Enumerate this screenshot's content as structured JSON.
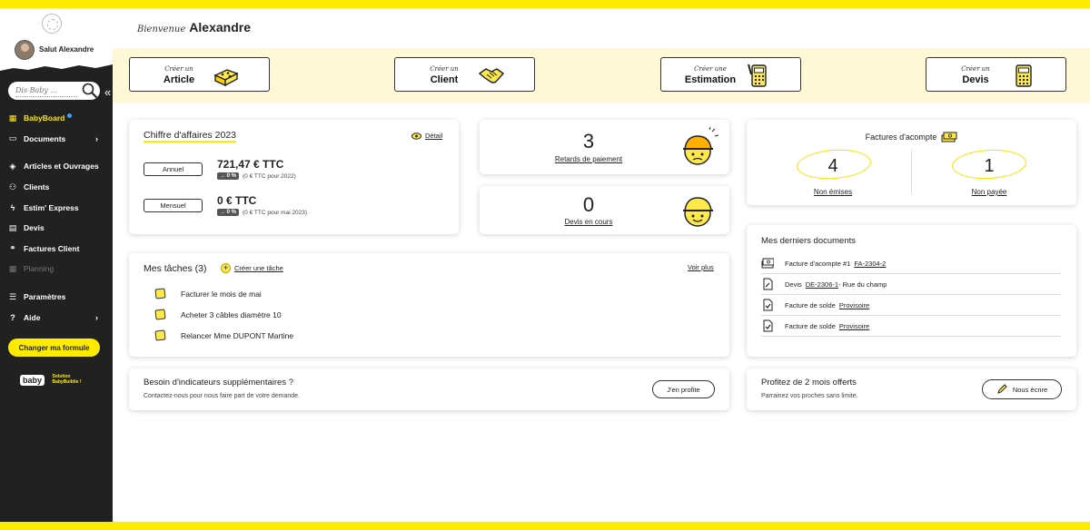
{
  "colors": {
    "accent": "#ffeb00",
    "sidebar": "#212121",
    "quick_bg": "#fff8d6",
    "link_dot": "#3ba0ff"
  },
  "sidebar": {
    "greeting": "Salut Alexandre",
    "search_placeholder": "Dis Baby ...",
    "items": [
      {
        "label": "BabyBoard",
        "icon": "grid-icon"
      },
      {
        "label": "Documents",
        "icon": "folder-icon"
      },
      {
        "label": "Articles et Ouvrages",
        "icon": "tags-icon"
      },
      {
        "label": "Clients",
        "icon": "users-icon"
      },
      {
        "label": "Estim' Express",
        "icon": "bolt-icon"
      },
      {
        "label": "Devis",
        "icon": "document-icon"
      },
      {
        "label": "Factures Client",
        "icon": "handshake-icon"
      },
      {
        "label": "Planning",
        "icon": "calendar-icon"
      },
      {
        "label": "Paramètres",
        "icon": "sliders-icon"
      },
      {
        "label": "Aide",
        "icon": "help-icon"
      }
    ],
    "formule_button": "Changer ma formule",
    "brand_name": "baby",
    "brand_tagline_1": "Solution",
    "brand_tagline_2": "BabyBuildie !"
  },
  "header": {
    "hello": "Bienvenue",
    "name": "Alexandre"
  },
  "quick_actions": [
    {
      "pre": "Créer un",
      "label": "Article",
      "icon": "brick-icon"
    },
    {
      "pre": "Créer un",
      "label": "Client",
      "icon": "handshake-icon"
    },
    {
      "pre": "Créer une",
      "label": "Estimation",
      "icon": "calculator-pencil-icon"
    },
    {
      "pre": "Créer un",
      "label": "Devis",
      "icon": "calculator-icon"
    }
  ],
  "revenue": {
    "title": "Chiffre d'affaires 2023",
    "detail": "Détail",
    "annual": {
      "tab": "Annuel",
      "value": "721,47 € TTC",
      "badge": "→ 0 %",
      "compare": "(0 € TTC pour 2022)"
    },
    "monthly": {
      "tab": "Mensuel",
      "value": "0 € TTC",
      "badge": "→ 0 %",
      "compare": "(0 € TTC pour mai 2023)"
    }
  },
  "late_payments": {
    "count": "3",
    "label": "Retards de paiement"
  },
  "quotes_open": {
    "count": "0",
    "label": "Devis en cours"
  },
  "deposits": {
    "title": "Factures d'acompte",
    "not_issued": {
      "count": "4",
      "label": "Non émises"
    },
    "unpaid": {
      "count": "1",
      "label": "Non payée"
    }
  },
  "tasks": {
    "title": "Mes tâches",
    "count": "(3)",
    "create": "Créer une tâche",
    "see_more": "Voir plus",
    "items": [
      "Facturer le mois de mai",
      "Acheter 3 câbles diamètre 10",
      "Relancer Mme DUPONT Martine"
    ]
  },
  "documents": {
    "title": "Mes derniers documents",
    "rows": [
      {
        "prefix": "Facture d'acompte #1",
        "link": "FA-2304-2",
        "suffix": "",
        "icon": "money-stack-icon"
      },
      {
        "prefix": "Devis",
        "link": "DE-2306-1",
        "suffix": " - Rue du champ",
        "icon": "document-pen-icon"
      },
      {
        "prefix": "Facture de solde",
        "link": "Provisoire",
        "suffix": "",
        "icon": "document-check-icon"
      },
      {
        "prefix": "Facture de solde",
        "link": "Provisoire",
        "suffix": "",
        "icon": "document-check-icon"
      }
    ]
  },
  "indicators": {
    "title": "Besoin d'indicateurs supplémentaires ?",
    "text": "Contactez-nous pour nous faire part de votre demande.",
    "button": "J'en profite"
  },
  "referral": {
    "title": "Profitez de 2 mois offerts",
    "text": "Parrainez vos proches sans limite.",
    "button": "Nous écrire"
  }
}
